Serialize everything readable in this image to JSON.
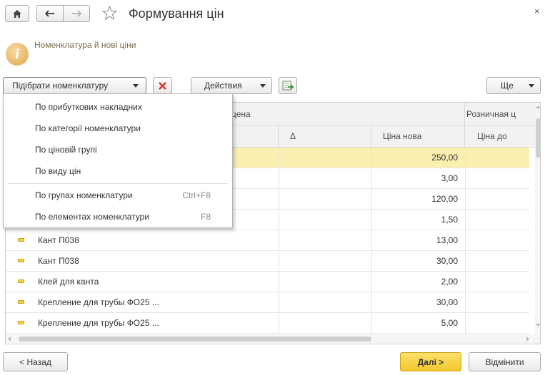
{
  "window": {
    "title": "Формування цін",
    "close_glyph": "×"
  },
  "info": {
    "text": "Номенклатура й нові ціни"
  },
  "toolbar": {
    "pick_label": "Підібрати номенклатуру",
    "actions_label": "Действия",
    "more_label": "Ще"
  },
  "grid": {
    "group_header_cena": "цена",
    "group_header_retail": "Розничная ц",
    "col_delta": "Δ",
    "col_new_price": "Ціна нова",
    "col_price_before": "Ціна до",
    "rows": [
      {
        "name": "",
        "new_price": "250,00",
        "selected": true
      },
      {
        "name": "",
        "new_price": "3,00"
      },
      {
        "name": "",
        "new_price": "120,00"
      },
      {
        "name": "",
        "new_price": "1,50"
      },
      {
        "name": "Кант П038",
        "new_price": "13,00"
      },
      {
        "name": "Кант П038",
        "new_price": "30,00"
      },
      {
        "name": "Клей для канта",
        "new_price": "2,00"
      },
      {
        "name": "Крепление для трубы ФО25 ...",
        "new_price": "30,00"
      },
      {
        "name": "Крепление для трубы ФО25 ...",
        "new_price": "5,00"
      }
    ]
  },
  "menu": {
    "items": [
      {
        "label": "По прибуткових накладних",
        "shortcut": ""
      },
      {
        "label": "По категорії номенклатури",
        "shortcut": ""
      },
      {
        "label": "По ціновій групі",
        "shortcut": ""
      },
      {
        "label": "По виду цін",
        "shortcut": ""
      },
      {
        "label": "По групах номенклатури",
        "shortcut": "Ctrl+F8"
      },
      {
        "label": "По елементах номенклатури",
        "shortcut": "F8"
      }
    ]
  },
  "footer": {
    "back_label": "< Назад",
    "next_label": "Далі >",
    "cancel_label": "Відмінити"
  },
  "colors": {
    "accent_yellow": "#f7d547",
    "selected_row": "#fbefb0",
    "info_text": "#7a6a4a"
  }
}
